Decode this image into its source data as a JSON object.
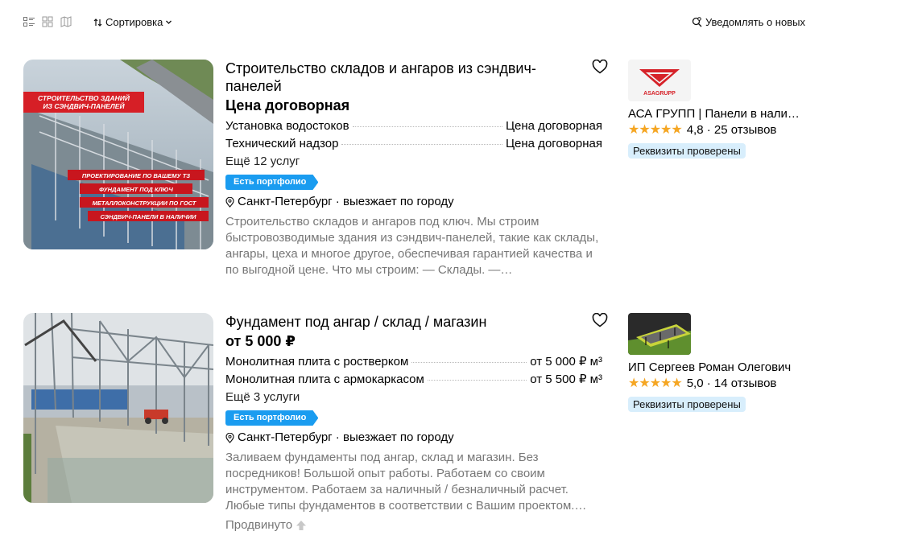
{
  "toolbar": {
    "sort_label": "Сортировка",
    "notify_label": "Уведомлять о новых"
  },
  "listings": [
    {
      "title": "Строительство складов и ангаров из сэндвич-панелей",
      "price": "Цена договорная",
      "services": [
        {
          "name": "Установка водостоков",
          "price": "Цена договорная"
        },
        {
          "name": "Технический надзор",
          "price": "Цена договорная"
        }
      ],
      "more_services": "Ещё 12 услуг",
      "badge": "Есть портфолио",
      "location": "Санкт-Петербург · выезжает по городу",
      "description": "Строительство складов и ангаров под ключ. Мы строим быстровозводимые здания из сэндвич-панелей, такие как склады, ангары, цеха и многое другое, обеспечивая гарантией качества и по выгодной цене. Что мы строим: — Склады. —…",
      "image_text": {
        "banner": "СТРОИТЕЛЬСТВО ЗДАНИЙ ИЗ СЭНДВИЧ-ПАНЕЛЕЙ",
        "line1": "ПРОЕКТИРОВАНИЕ ПО ВАШЕМУ ТЗ",
        "line2": "ФУНДАМЕНТ ПОД КЛЮЧ",
        "line3": "МЕТАЛЛОКОНСТРУКЦИИ ПО ГОСТ",
        "line4": "СЭНДВИЧ-ПАНЕЛИ В НАЛИЧИИ"
      },
      "seller": {
        "name": "АСА ГРУПП | Панели в налич…",
        "logo_text": "ASAGRUPP",
        "stars": "★★★★★",
        "rating": "4,8 · 25 отзывов",
        "verified": "Реквизиты проверены"
      }
    },
    {
      "title": "Фундамент под ангар / склад / магазин",
      "price": "от 5 000 ₽",
      "services": [
        {
          "name": "Монолитная плита с ростверком",
          "price": "от 5 000 ₽ м³"
        },
        {
          "name": "Монолитная плита с армокаркасом",
          "price": "от 5 500 ₽ м³"
        }
      ],
      "more_services": "Ещё 3 услуги",
      "badge": "Есть портфолио",
      "location": "Санкт-Петербург · выезжает по городу",
      "description": "Заливаем фундаменты под ангар, склад и магазин. Без посредников! Большой опыт работы. Работаем со своим инструментом. Работаем за наличный / безналичный расчет. Любые типы фундаментов в соответствии с Вашим проектом.…",
      "promoted": "Продвинуто",
      "seller": {
        "name": "ИП Сергеев Роман Олегович",
        "stars": "★★★★★",
        "rating": "5,0 · 14 отзывов",
        "verified": "Реквизиты проверены"
      }
    }
  ],
  "colors": {
    "badge_blue": "#1a9cf0",
    "verified_bg": "#d8eefc",
    "star": "#f5a623",
    "muted_text": "#777777"
  }
}
